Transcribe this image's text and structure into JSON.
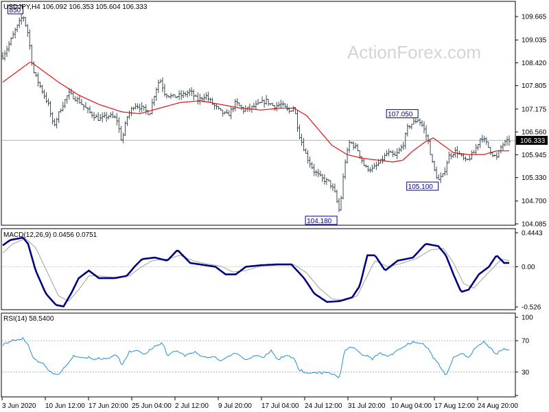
{
  "colors": {
    "price_bars": "#3a4a52",
    "ma": "#e01010",
    "macd": "#000080",
    "signal": "#a0a0a0",
    "rsi": "#1e8fd6",
    "current_price_box": "#000000",
    "grid": "#c8c8c8"
  },
  "watermark": "ActionForex.com",
  "chart_data": [
    {
      "type": "ohlc",
      "title": "USDJPY,H4  106.092 106.353 105.604 106.333",
      "ylim": [
        104.085,
        110.0
      ],
      "yticks": [
        "109.665",
        "109.035",
        "108.420",
        "107.805",
        "107.175",
        "106.560",
        "105.945",
        "105.330",
        "104.700",
        "104.085"
      ],
      "current_price": "106.333",
      "x_labels": [
        "3 Jun 2020",
        "10 Jun 12:00",
        "17 Jun 20:00",
        "25 Jun 04:00",
        "2 Jul 12:00",
        "9 Jul 20:00",
        "17 Jul 04:00",
        "24 Jul 12:00",
        "31 Jul 20:00",
        "10 Aug 04:00",
        "17 Aug 12:00",
        "24 Aug 20:00"
      ],
      "annotations": [
        {
          "label": "850",
          "t": 0.04,
          "value": 109.85
        },
        {
          "label": "107.050",
          "t": 0.82,
          "value": 107.05
        },
        {
          "label": "105.100",
          "t": 0.86,
          "value": 105.1
        },
        {
          "label": "104.180",
          "t": 0.66,
          "value": 104.18
        }
      ],
      "close_anchors": [
        [
          0.0,
          108.6
        ],
        [
          0.01,
          108.85
        ],
        [
          0.025,
          109.3
        ],
        [
          0.04,
          109.7
        ],
        [
          0.05,
          109.2
        ],
        [
          0.06,
          108.2
        ],
        [
          0.075,
          107.75
        ],
        [
          0.09,
          107.3
        ],
        [
          0.1,
          106.7
        ],
        [
          0.115,
          107.2
        ],
        [
          0.13,
          107.6
        ],
        [
          0.15,
          107.4
        ],
        [
          0.17,
          107.1
        ],
        [
          0.19,
          106.9
        ],
        [
          0.21,
          107.0
        ],
        [
          0.225,
          106.9
        ],
        [
          0.235,
          106.3
        ],
        [
          0.245,
          106.95
        ],
        [
          0.26,
          107.3
        ],
        [
          0.275,
          107.2
        ],
        [
          0.29,
          107.05
        ],
        [
          0.3,
          107.6
        ],
        [
          0.31,
          108.0
        ],
        [
          0.32,
          107.6
        ],
        [
          0.335,
          107.5
        ],
        [
          0.355,
          107.55
        ],
        [
          0.37,
          107.65
        ],
        [
          0.385,
          107.4
        ],
        [
          0.4,
          107.55
        ],
        [
          0.415,
          107.3
        ],
        [
          0.43,
          107.1
        ],
        [
          0.445,
          107.0
        ],
        [
          0.46,
          107.35
        ],
        [
          0.475,
          107.15
        ],
        [
          0.49,
          107.2
        ],
        [
          0.505,
          107.3
        ],
        [
          0.52,
          107.4
        ],
        [
          0.535,
          107.25
        ],
        [
          0.55,
          107.3
        ],
        [
          0.565,
          107.1
        ],
        [
          0.575,
          107.25
        ],
        [
          0.585,
          106.5
        ],
        [
          0.6,
          105.9
        ],
        [
          0.615,
          105.5
        ],
        [
          0.63,
          105.3
        ],
        [
          0.645,
          105.2
        ],
        [
          0.655,
          104.95
        ],
        [
          0.665,
          104.4
        ],
        [
          0.675,
          105.7
        ],
        [
          0.685,
          106.3
        ],
        [
          0.7,
          106.1
        ],
        [
          0.715,
          105.6
        ],
        [
          0.73,
          105.55
        ],
        [
          0.745,
          105.75
        ],
        [
          0.76,
          106.0
        ],
        [
          0.775,
          105.9
        ],
        [
          0.79,
          106.2
        ],
        [
          0.8,
          106.7
        ],
        [
          0.81,
          106.8
        ],
        [
          0.82,
          106.9
        ],
        [
          0.83,
          106.7
        ],
        [
          0.84,
          106.3
        ],
        [
          0.85,
          105.6
        ],
        [
          0.86,
          105.25
        ],
        [
          0.87,
          105.4
        ],
        [
          0.88,
          105.9
        ],
        [
          0.895,
          106.05
        ],
        [
          0.905,
          105.9
        ],
        [
          0.915,
          105.75
        ],
        [
          0.93,
          106.0
        ],
        [
          0.945,
          106.45
        ],
        [
          0.955,
          106.25
        ],
        [
          0.965,
          106.0
        ],
        [
          0.975,
          105.85
        ],
        [
          0.985,
          106.2
        ],
        [
          1.0,
          106.33
        ]
      ],
      "ma_anchors": [
        [
          0.0,
          107.9
        ],
        [
          0.03,
          108.2
        ],
        [
          0.055,
          108.45
        ],
        [
          0.08,
          108.2
        ],
        [
          0.11,
          107.9
        ],
        [
          0.15,
          107.55
        ],
        [
          0.19,
          107.3
        ],
        [
          0.235,
          107.1
        ],
        [
          0.27,
          107.05
        ],
        [
          0.31,
          107.2
        ],
        [
          0.35,
          107.35
        ],
        [
          0.39,
          107.4
        ],
        [
          0.43,
          107.3
        ],
        [
          0.47,
          107.2
        ],
        [
          0.51,
          107.15
        ],
        [
          0.55,
          107.2
        ],
        [
          0.575,
          107.2
        ],
        [
          0.6,
          107.0
        ],
        [
          0.625,
          106.6
        ],
        [
          0.65,
          106.2
        ],
        [
          0.68,
          105.95
        ],
        [
          0.71,
          105.85
        ],
        [
          0.74,
          105.8
        ],
        [
          0.77,
          105.75
        ],
        [
          0.79,
          105.8
        ],
        [
          0.81,
          106.05
        ],
        [
          0.835,
          106.3
        ],
        [
          0.85,
          106.4
        ],
        [
          0.87,
          106.2
        ],
        [
          0.89,
          106.0
        ],
        [
          0.92,
          105.95
        ],
        [
          0.95,
          105.95
        ],
        [
          0.975,
          106.05
        ],
        [
          1.0,
          106.05
        ]
      ]
    },
    {
      "type": "line",
      "title": "MACD(12,26,9)  0.0456  0.0751",
      "ylim": [
        -0.526,
        0.4443
      ],
      "yticks": [
        "0.4443",
        "0.00",
        "-0.526"
      ],
      "series": [
        {
          "role": "macd",
          "anchors": [
            [
              0.0,
              0.28
            ],
            [
              0.015,
              0.35
            ],
            [
              0.04,
              0.38
            ],
            [
              0.05,
              0.3
            ],
            [
              0.065,
              -0.05
            ],
            [
              0.085,
              -0.35
            ],
            [
              0.105,
              -0.5
            ],
            [
              0.12,
              -0.52
            ],
            [
              0.135,
              -0.35
            ],
            [
              0.15,
              -0.15
            ],
            [
              0.17,
              -0.05
            ],
            [
              0.19,
              -0.15
            ],
            [
              0.22,
              -0.15
            ],
            [
              0.245,
              -0.12
            ],
            [
              0.26,
              0.0
            ],
            [
              0.275,
              0.1
            ],
            [
              0.3,
              0.12
            ],
            [
              0.325,
              0.08
            ],
            [
              0.345,
              0.22
            ],
            [
              0.37,
              0.05
            ],
            [
              0.39,
              0.03
            ],
            [
              0.42,
              0.0
            ],
            [
              0.44,
              -0.1
            ],
            [
              0.46,
              -0.1
            ],
            [
              0.48,
              0.0
            ],
            [
              0.51,
              0.02
            ],
            [
              0.54,
              0.03
            ],
            [
              0.57,
              0.03
            ],
            [
              0.595,
              -0.15
            ],
            [
              0.615,
              -0.35
            ],
            [
              0.64,
              -0.46
            ],
            [
              0.665,
              -0.45
            ],
            [
              0.69,
              -0.4
            ],
            [
              0.705,
              -0.25
            ],
            [
              0.72,
              0.15
            ],
            [
              0.735,
              0.15
            ],
            [
              0.755,
              -0.05
            ],
            [
              0.78,
              0.08
            ],
            [
              0.81,
              0.12
            ],
            [
              0.835,
              0.3
            ],
            [
              0.86,
              0.27
            ],
            [
              0.875,
              0.15
            ],
            [
              0.89,
              -0.1
            ],
            [
              0.905,
              -0.33
            ],
            [
              0.92,
              -0.3
            ],
            [
              0.94,
              -0.1
            ],
            [
              0.96,
              0.0
            ],
            [
              0.975,
              0.15
            ],
            [
              0.99,
              0.05
            ],
            [
              1.0,
              0.05
            ]
          ]
        },
        {
          "role": "signal",
          "anchors": [
            [
              0.0,
              0.18
            ],
            [
              0.02,
              0.3
            ],
            [
              0.045,
              0.37
            ],
            [
              0.065,
              0.25
            ],
            [
              0.09,
              -0.1
            ],
            [
              0.11,
              -0.38
            ],
            [
              0.13,
              -0.45
            ],
            [
              0.15,
              -0.3
            ],
            [
              0.17,
              -0.12
            ],
            [
              0.19,
              -0.12
            ],
            [
              0.22,
              -0.14
            ],
            [
              0.25,
              -0.12
            ],
            [
              0.27,
              -0.02
            ],
            [
              0.295,
              0.08
            ],
            [
              0.325,
              0.1
            ],
            [
              0.35,
              0.15
            ],
            [
              0.375,
              0.08
            ],
            [
              0.4,
              0.04
            ],
            [
              0.43,
              0.01
            ],
            [
              0.455,
              -0.07
            ],
            [
              0.48,
              -0.05
            ],
            [
              0.51,
              0.01
            ],
            [
              0.54,
              0.02
            ],
            [
              0.575,
              0.03
            ],
            [
              0.6,
              -0.08
            ],
            [
              0.625,
              -0.28
            ],
            [
              0.65,
              -0.42
            ],
            [
              0.675,
              -0.44
            ],
            [
              0.7,
              -0.38
            ],
            [
              0.715,
              -0.18
            ],
            [
              0.735,
              0.08
            ],
            [
              0.76,
              0.0
            ],
            [
              0.785,
              0.04
            ],
            [
              0.815,
              0.1
            ],
            [
              0.845,
              0.22
            ],
            [
              0.87,
              0.24
            ],
            [
              0.89,
              0.05
            ],
            [
              0.91,
              -0.22
            ],
            [
              0.93,
              -0.28
            ],
            [
              0.95,
              -0.14
            ],
            [
              0.97,
              0.0
            ],
            [
              0.985,
              0.1
            ],
            [
              1.0,
              0.08
            ]
          ]
        }
      ]
    },
    {
      "type": "line",
      "title": "RSI(14)  58.5400",
      "ylim": [
        0,
        100
      ],
      "yticks": [
        "100",
        "70",
        "30",
        "0"
      ],
      "levels": [
        70,
        30
      ],
      "series": [
        {
          "role": "rsi",
          "anchors": [
            [
              0.0,
              66
            ],
            [
              0.02,
              70
            ],
            [
              0.04,
              72
            ],
            [
              0.05,
              65
            ],
            [
              0.06,
              48
            ],
            [
              0.08,
              40
            ],
            [
              0.095,
              30
            ],
            [
              0.11,
              26
            ],
            [
              0.125,
              38
            ],
            [
              0.14,
              50
            ],
            [
              0.16,
              48
            ],
            [
              0.18,
              47
            ],
            [
              0.2,
              46
            ],
            [
              0.225,
              52
            ],
            [
              0.235,
              38
            ],
            [
              0.25,
              55
            ],
            [
              0.265,
              58
            ],
            [
              0.28,
              52
            ],
            [
              0.3,
              62
            ],
            [
              0.315,
              68
            ],
            [
              0.325,
              50
            ],
            [
              0.34,
              58
            ],
            [
              0.36,
              52
            ],
            [
              0.38,
              55
            ],
            [
              0.4,
              48
            ],
            [
              0.415,
              50
            ],
            [
              0.43,
              44
            ],
            [
              0.445,
              50
            ],
            [
              0.46,
              55
            ],
            [
              0.48,
              45
            ],
            [
              0.5,
              52
            ],
            [
              0.515,
              48
            ],
            [
              0.53,
              57
            ],
            [
              0.545,
              45
            ],
            [
              0.56,
              52
            ],
            [
              0.575,
              48
            ],
            [
              0.585,
              32
            ],
            [
              0.6,
              28
            ],
            [
              0.62,
              30
            ],
            [
              0.64,
              30
            ],
            [
              0.655,
              27
            ],
            [
              0.665,
              22
            ],
            [
              0.675,
              58
            ],
            [
              0.69,
              63
            ],
            [
              0.71,
              52
            ],
            [
              0.73,
              48
            ],
            [
              0.745,
              55
            ],
            [
              0.76,
              50
            ],
            [
              0.78,
              58
            ],
            [
              0.8,
              65
            ],
            [
              0.815,
              68
            ],
            [
              0.83,
              66
            ],
            [
              0.845,
              55
            ],
            [
              0.86,
              40
            ],
            [
              0.875,
              25
            ],
            [
              0.89,
              48
            ],
            [
              0.905,
              54
            ],
            [
              0.92,
              48
            ],
            [
              0.935,
              62
            ],
            [
              0.95,
              68
            ],
            [
              0.965,
              60
            ],
            [
              0.975,
              52
            ],
            [
              0.985,
              58
            ],
            [
              1.0,
              58.54
            ]
          ]
        }
      ]
    }
  ]
}
